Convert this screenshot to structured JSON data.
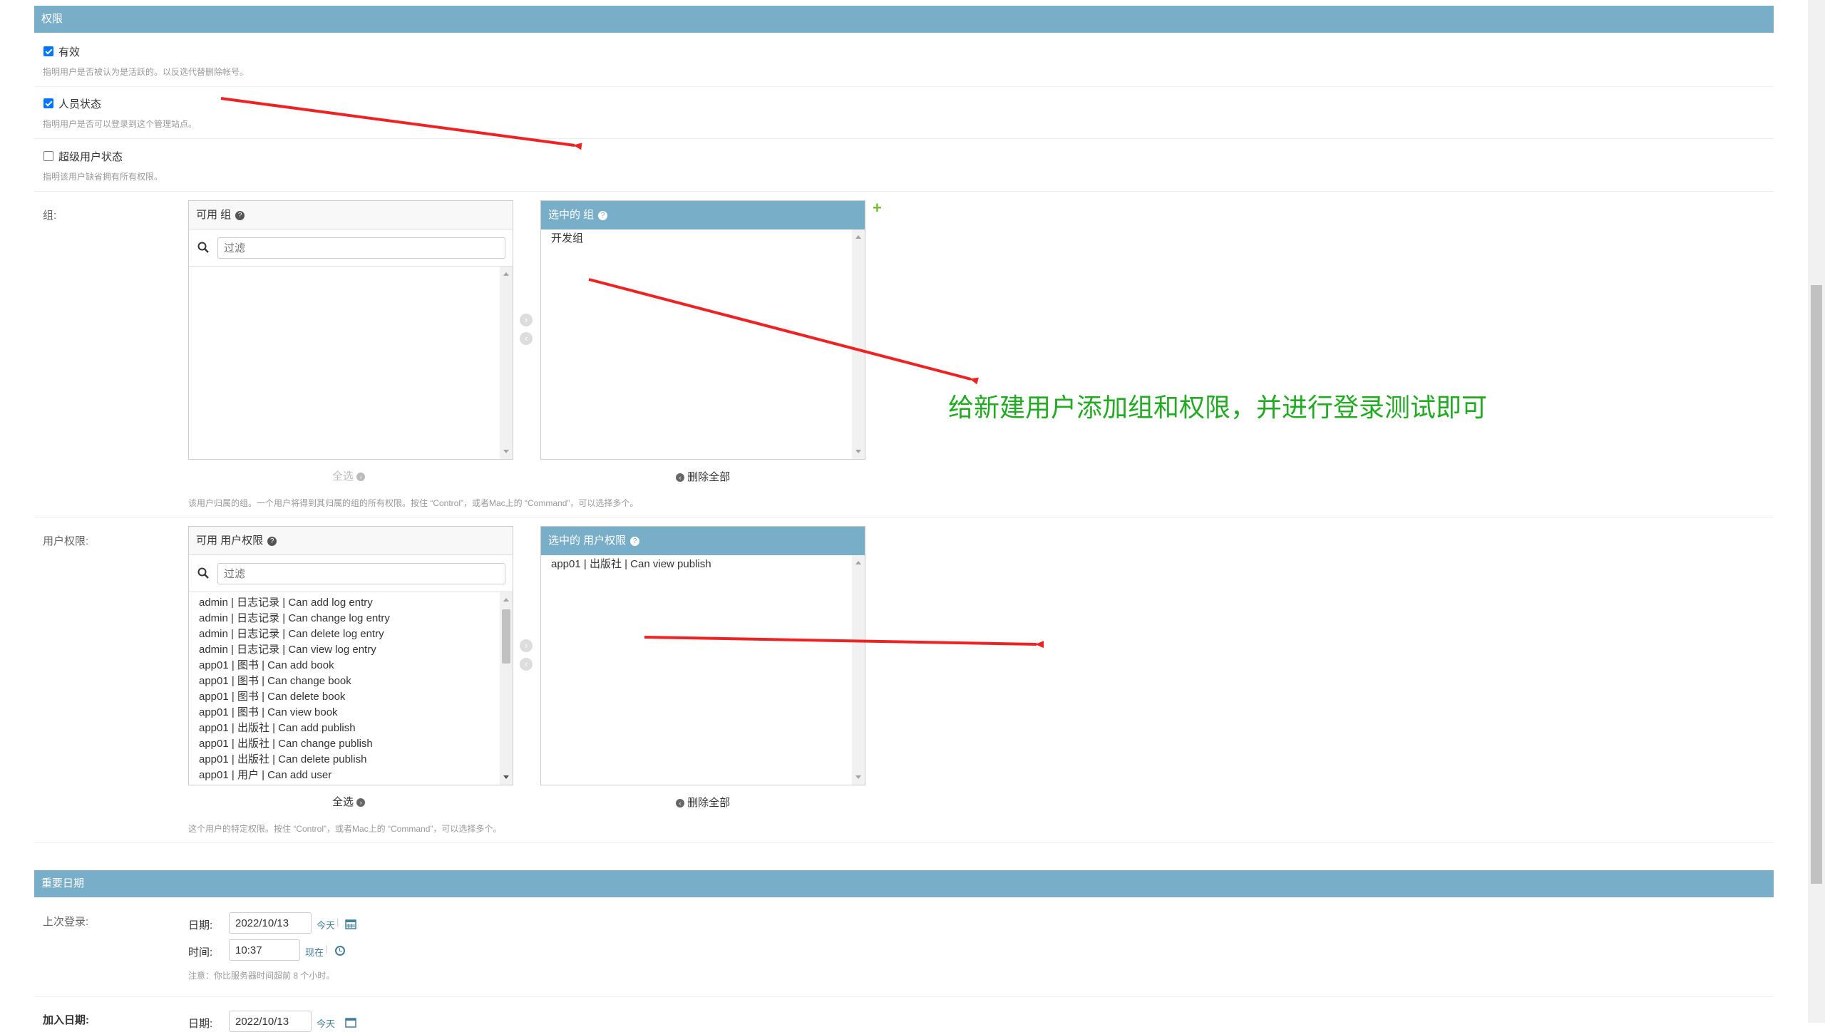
{
  "permissions": {
    "header": "权限",
    "active": {
      "label": "有效",
      "checked": true,
      "help": "指明用户是否被认为是活跃的。以反选代替删除帐号。"
    },
    "staff": {
      "label": "人员状态",
      "checked": true,
      "help": "指明用户是否可以登录到这个管理站点。"
    },
    "superuser": {
      "label": "超级用户状态",
      "checked": false,
      "help": "指明该用户缺省拥有所有权限。"
    },
    "groups": {
      "label": "组:",
      "available_title": "可用 组",
      "chosen_title": "选中的 组",
      "filter_placeholder": "过滤",
      "available_items": [],
      "chosen_items": [
        "开发组"
      ],
      "select_all": "全选",
      "remove_all": "删除全部",
      "help": "该用户归属的组。一个用户将得到其归属的组的所有权限。按住 “Control”，或者Mac上的 “Command”，可以选择多个。"
    },
    "user_permissions": {
      "label": "用户权限:",
      "available_title": "可用 用户权限",
      "chosen_title": "选中的 用户权限",
      "filter_placeholder": "过滤",
      "available_items": [
        "admin | 日志记录 | Can add log entry",
        "admin | 日志记录 | Can change log entry",
        "admin | 日志记录 | Can delete log entry",
        "admin | 日志记录 | Can view log entry",
        "app01 | 图书 | Can add book",
        "app01 | 图书 | Can change book",
        "app01 | 图书 | Can delete book",
        "app01 | 图书 | Can view book",
        "app01 | 出版社 | Can add publish",
        "app01 | 出版社 | Can change publish",
        "app01 | 出版社 | Can delete publish",
        "app01 | 用户 | Can add user"
      ],
      "chosen_items": [
        "app01 | 出版社 | Can view publish"
      ],
      "select_all": "全选",
      "remove_all": "删除全部",
      "help": "这个用户的特定权限。按住 “Control”，或者Mac上的 “Command”，可以选择多个。"
    }
  },
  "annotation": "给新建用户添加组和权限，并进行登录测试即可",
  "important_dates": {
    "header": "重要日期",
    "last_login": {
      "label": "上次登录:",
      "date_label": "日期:",
      "date_value": "2022/10/13",
      "today_link": "今天",
      "time_label": "时间:",
      "time_value": "10:37",
      "now_link": "现在",
      "note": "注意：你比服务器时间超前 8 个小时。"
    },
    "date_joined": {
      "label": "加入日期:",
      "date_label": "日期:",
      "date_value": "2022/10/13",
      "today_link": "今天"
    }
  },
  "colors": {
    "module_header": "#79aec8",
    "annotation_text": "#22aa22",
    "annotation_arrow": "#ee2222",
    "link": "#447e9b",
    "add_icon": "#70bf2b"
  }
}
